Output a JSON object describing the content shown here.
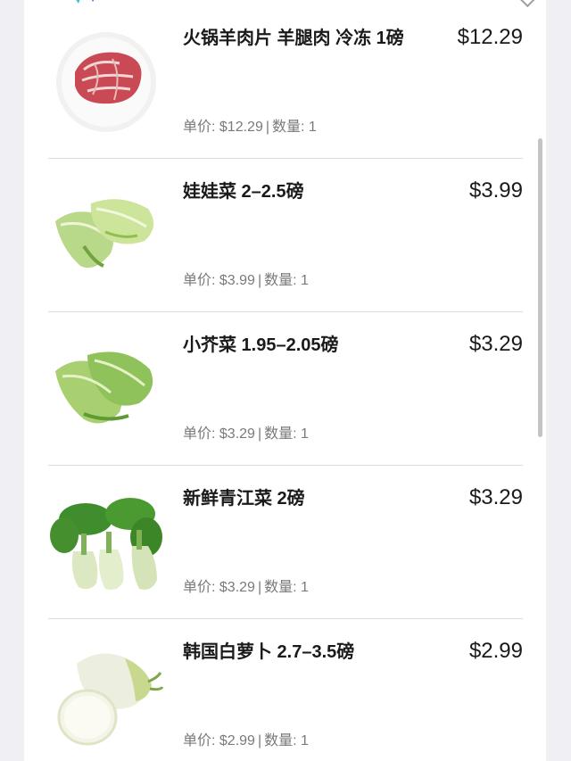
{
  "products": [
    {
      "name": "火锅羊肉片 羊腿肉 冷冻 1磅",
      "price": "$12.29",
      "unit_price_label": "单价:",
      "unit_price": "$12.29",
      "qty_label": "数量:",
      "qty": "1",
      "icon": "lamb-slices-plate-icon"
    },
    {
      "name": "娃娃菜 2–2.5磅",
      "price": "$3.99",
      "unit_price_label": "单价:",
      "unit_price": "$3.99",
      "qty_label": "数量:",
      "qty": "1",
      "icon": "baby-napa-cabbage-icon"
    },
    {
      "name": "小芥菜 1.95–2.05磅",
      "price": "$3.29",
      "unit_price_label": "单价:",
      "unit_price": "$3.29",
      "qty_label": "数量:",
      "qty": "1",
      "icon": "mustard-greens-icon"
    },
    {
      "name": "新鲜青江菜 2磅",
      "price": "$3.29",
      "unit_price_label": "单价:",
      "unit_price": "$3.29",
      "qty_label": "数量:",
      "qty": "1",
      "icon": "bok-choy-icon"
    },
    {
      "name": "韩国白萝卜 2.7–3.5磅",
      "price": "$2.99",
      "unit_price_label": "单价:",
      "unit_price": "$2.99",
      "qty_label": "数量:",
      "qty": "1",
      "icon": "korean-radish-icon"
    }
  ],
  "colors": {
    "text": "#1a1a1a",
    "meta": "#7a7a7a",
    "divider": "#dcdcdc",
    "logo_teal": "#3cc3c8",
    "logo_blue": "#2f6fd6"
  }
}
